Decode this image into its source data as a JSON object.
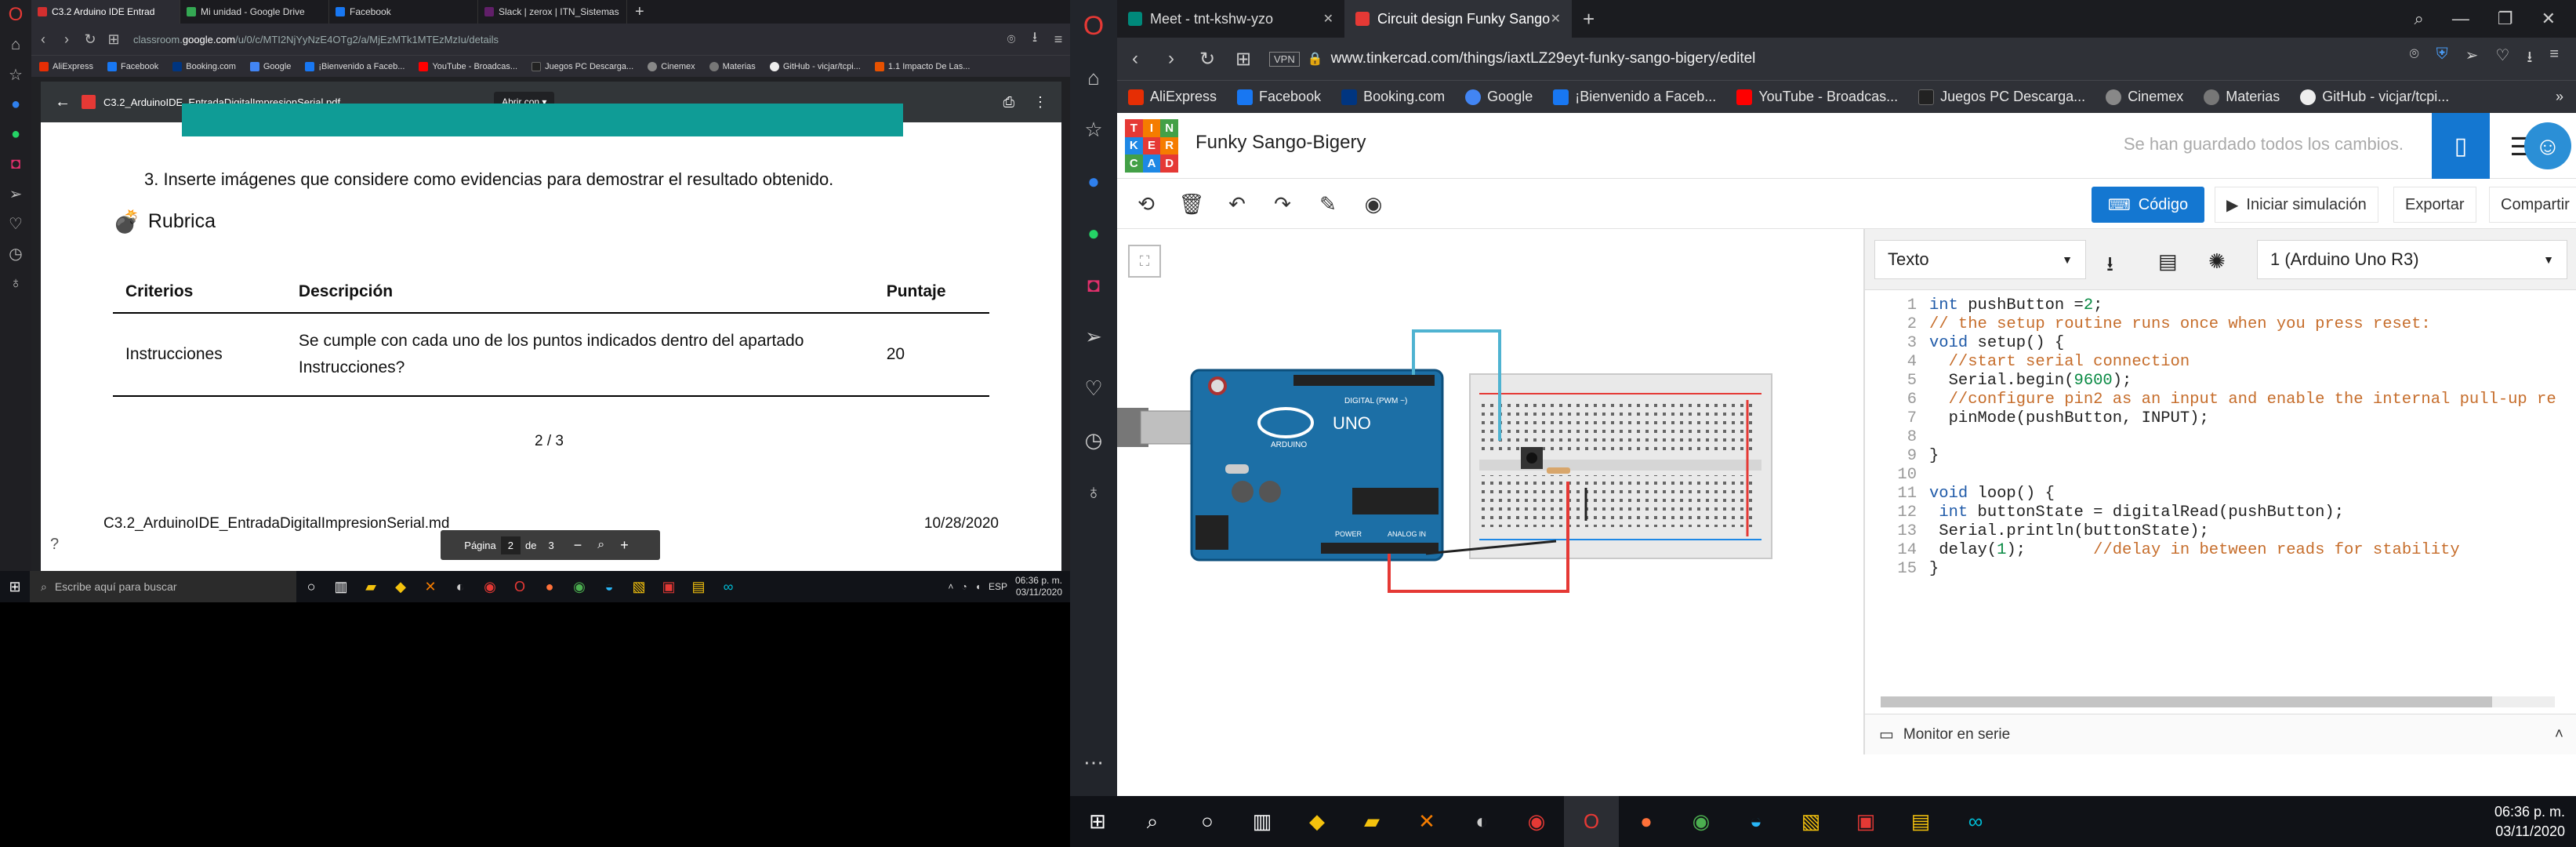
{
  "left": {
    "tabs": [
      {
        "label": "C3.2 Arduino IDE Entrad",
        "color": "#d32f2f"
      },
      {
        "label": "Mi unidad - Google Drive",
        "color": "#34a853"
      },
      {
        "label": "Facebook",
        "color": "#1877f2"
      },
      {
        "label": "Slack | zerox | ITN_Sistemas",
        "color": "#611f69"
      }
    ],
    "url_prefix": "classroom.",
    "url_host": "google.com",
    "url_path": "/u/0/c/MTI2NjYyNzE4OTg2/a/MjEzMTk1MTEzMzIu/details",
    "bookmarks": [
      {
        "label": "AliExpress",
        "color": "#e62e04"
      },
      {
        "label": "Facebook",
        "color": "#1877f2"
      },
      {
        "label": "Booking.com",
        "color": "#003580"
      },
      {
        "label": "Google",
        "color": "#4285f4"
      },
      {
        "label": "¡Bienvenido a Faceb...",
        "color": "#1877f2"
      },
      {
        "label": "YouTube - Broadcas...",
        "color": "#ff0000"
      },
      {
        "label": "Juegos PC Descarga...",
        "color": "#222"
      },
      {
        "label": "Cinemex",
        "color": "#888"
      },
      {
        "label": "Materias",
        "color": "#777"
      },
      {
        "label": "GitHub - vicjar/tcpi...",
        "color": "#eee"
      },
      {
        "label": "1.1 Impacto De Las...",
        "color": "#e65100"
      }
    ],
    "pdf": {
      "filename": "C3.2_ArduinoIDE_EntradaDigitalImpresionSerial.pdf",
      "open_with": "Abrir con",
      "instruction": "3. Inserte imágenes que considere como evidencias para demostrar el resultado obtenido.",
      "rubric_title": "Rubrica",
      "table_headers": [
        "Criterios",
        "Descripción",
        "Puntaje"
      ],
      "table_rows": [
        [
          "Instrucciones",
          "Se cumple con cada uno de los puntos indicados dentro del apartado Instrucciones?",
          "20"
        ]
      ],
      "page_indicator": "2 / 3",
      "footer_name": "C3.2_ArduinoIDE_EntradaDigitalImpresionSerial.md",
      "footer_date": "10/28/2020",
      "pager": {
        "label": "Página",
        "page": "2",
        "of": "de",
        "total": "3"
      }
    },
    "taskbar": {
      "search_placeholder": "Escribe aquí para buscar",
      "lang": "ESP",
      "time": "06:36 p. m.",
      "date": "03/11/2020"
    }
  },
  "right": {
    "tabs": [
      {
        "label": "Meet - tnt-kshw-yzo",
        "color": "#00897b"
      },
      {
        "label": "Circuit design Funky Sango",
        "color": "#e53935"
      }
    ],
    "vpn": "VPN",
    "url": "www.tinkercad.com/things/iaxtLZ29eyt-funky-sango-bigery/editel",
    "bookmarks": [
      {
        "label": "AliExpress",
        "color": "#e62e04"
      },
      {
        "label": "Facebook",
        "color": "#1877f2"
      },
      {
        "label": "Booking.com",
        "color": "#003580"
      },
      {
        "label": "Google",
        "color": "#4285f4"
      },
      {
        "label": "¡Bienvenido a Faceb...",
        "color": "#1877f2"
      },
      {
        "label": "YouTube - Broadcas...",
        "color": "#ff0000"
      },
      {
        "label": "Juegos PC Descarga...",
        "color": "#222"
      },
      {
        "label": "Cinemex",
        "color": "#888"
      },
      {
        "label": "Materias",
        "color": "#777"
      },
      {
        "label": "GitHub - vicjar/tcpi...",
        "color": "#eee"
      }
    ],
    "tinkercad": {
      "logo_letters": [
        "T",
        "I",
        "N",
        "K",
        "E",
        "R",
        "C",
        "A",
        "D"
      ],
      "project_title": "Funky Sango-Bigery",
      "saved_status": "Se han guardado todos los cambios.",
      "code_button": "Código",
      "sim_button": "Iniciar simulación",
      "export_button": "Exportar",
      "share_button": "Compartir",
      "board_labels": {
        "uno": "UNO",
        "brand": "ARDUINO",
        "digital": "DIGITAL (PWM ~)",
        "power": "POWER",
        "analog": "ANALOG IN"
      },
      "code_mode": "Texto",
      "device": "1 (Arduino Uno R3)",
      "code_lines": [
        "int pushButton =2;",
        "// the setup routine runs once when you press reset:",
        "void setup() {",
        "  //start serial connection",
        "  Serial.begin(9600);",
        "  //configure pin2 as an input and enable the internal pull-up re",
        "  pinMode(pushButton, INPUT);",
        "",
        "}",
        "",
        "void loop() {",
        " int buttonState = digitalRead(pushButton);",
        " Serial.println(buttonState);",
        " delay(1);       //delay in between reads for stability",
        "}"
      ],
      "serial_monitor": "Monitor en serie"
    },
    "taskbar": {
      "time": "06:36 p. m.",
      "date": "03/11/2020"
    }
  }
}
